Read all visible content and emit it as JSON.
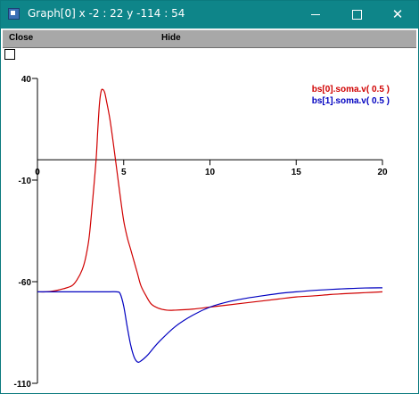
{
  "window": {
    "title": "Graph[0]  x -2 : 22  y -114 : 54",
    "icons": {
      "app": "app-icon",
      "minimize": "minimize-icon",
      "maximize": "maximize-icon",
      "close": "close-icon"
    },
    "close_glyph": "✕"
  },
  "menu": {
    "close_label": "Close",
    "hide_label": "Hide"
  },
  "colors": {
    "titlebar": "#0e8589",
    "series0": "#d00000",
    "series1": "#0000c0"
  },
  "chart_data": {
    "type": "line",
    "xlim": [
      0,
      20
    ],
    "ylim": [
      -110,
      40
    ],
    "x_ticks": [
      0,
      5,
      10,
      15,
      20
    ],
    "y_ticks": [
      40,
      -10,
      -60,
      -110
    ],
    "x_tick_labels": [
      "0",
      "5",
      "10",
      "15",
      "20"
    ],
    "y_tick_labels": [
      "40",
      "-10",
      "-60",
      "-110"
    ],
    "legend_placement": "top-right",
    "series": [
      {
        "name": "bs[0].soma.v( 0.5 )",
        "color": "#d00000",
        "points": [
          [
            0,
            -65
          ],
          [
            0.5,
            -65
          ],
          [
            1,
            -64.5
          ],
          [
            1.5,
            -63.5
          ],
          [
            2,
            -62
          ],
          [
            2.3,
            -59
          ],
          [
            2.6,
            -54
          ],
          [
            2.8,
            -48
          ],
          [
            3.0,
            -38
          ],
          [
            3.2,
            -20
          ],
          [
            3.4,
            0
          ],
          [
            3.5,
            15
          ],
          [
            3.6,
            28
          ],
          [
            3.7,
            34
          ],
          [
            3.8,
            34.5
          ],
          [
            3.9,
            33
          ],
          [
            4.0,
            29
          ],
          [
            4.2,
            20
          ],
          [
            4.4,
            8
          ],
          [
            4.6,
            -5
          ],
          [
            4.8,
            -18
          ],
          [
            5.0,
            -30
          ],
          [
            5.2,
            -38
          ],
          [
            5.4,
            -44
          ],
          [
            5.6,
            -50
          ],
          [
            5.8,
            -56
          ],
          [
            6.0,
            -62
          ],
          [
            6.3,
            -67
          ],
          [
            6.6,
            -71
          ],
          [
            7.0,
            -73
          ],
          [
            7.5,
            -74
          ],
          [
            8,
            -74
          ],
          [
            9,
            -73.5
          ],
          [
            10,
            -72.5
          ],
          [
            11,
            -71.5
          ],
          [
            12,
            -70.5
          ],
          [
            13,
            -69.5
          ],
          [
            14,
            -68.5
          ],
          [
            15,
            -67.5
          ],
          [
            16,
            -67
          ],
          [
            17,
            -66.3
          ],
          [
            18,
            -65.8
          ],
          [
            19,
            -65.4
          ],
          [
            20,
            -65
          ]
        ]
      },
      {
        "name": "bs[1].soma.v( 0.5 )",
        "color": "#0000c0",
        "points": [
          [
            0,
            -65
          ],
          [
            2,
            -65
          ],
          [
            4,
            -65
          ],
          [
            4.6,
            -65
          ],
          [
            4.8,
            -66
          ],
          [
            5.0,
            -72
          ],
          [
            5.2,
            -82
          ],
          [
            5.4,
            -91
          ],
          [
            5.6,
            -97
          ],
          [
            5.8,
            -99.5
          ],
          [
            6.0,
            -99
          ],
          [
            6.4,
            -96
          ],
          [
            7,
            -90
          ],
          [
            8,
            -82
          ],
          [
            9,
            -76.5
          ],
          [
            10,
            -72.5
          ],
          [
            11,
            -70
          ],
          [
            12,
            -68.3
          ],
          [
            13,
            -67
          ],
          [
            14,
            -65.8
          ],
          [
            15,
            -65
          ],
          [
            16,
            -64.3
          ],
          [
            17,
            -63.8
          ],
          [
            18,
            -63.4
          ],
          [
            19,
            -63.1
          ],
          [
            20,
            -63
          ]
        ]
      }
    ]
  }
}
